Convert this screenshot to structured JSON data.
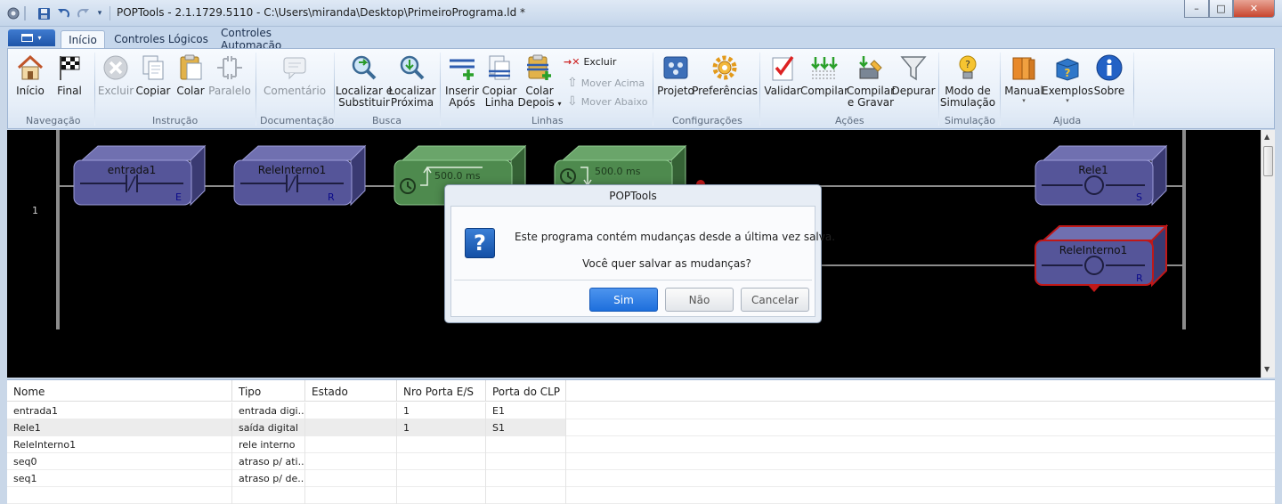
{
  "window": {
    "title": "POPTools - 2.1.1729.5110 - C:\\Users\\miranda\\Desktop\\PrimeiroPrograma.ld *",
    "minimize": "–",
    "maximize": "□",
    "close": "✕"
  },
  "tabs": [
    {
      "label": "Início",
      "active": true
    },
    {
      "label": "Controles Lógicos",
      "active": false
    },
    {
      "label": "Controles Automação",
      "active": false
    }
  ],
  "ribbon": {
    "groups": {
      "navegacao": "Navegação",
      "instrucao": "Instrução",
      "documentacao": "Documentação",
      "busca": "Busca",
      "linhas": "Linhas",
      "configuracoes": "Configurações",
      "acoes": "Ações",
      "simulacao": "Simulação",
      "ajuda": "Ajuda"
    },
    "buttons": {
      "inicio": "Início",
      "final": "Final",
      "excluir": "Excluir",
      "copiar": "Copiar",
      "colar": "Colar",
      "paralelo": "Paralelo",
      "comentario": "Comentário",
      "localizar_substituir_1": "Localizar e",
      "localizar_substituir_2": "Substituir",
      "localizar_proxima_1": "Localizar",
      "localizar_proxima_2": "Próxima",
      "inserir_apos_1": "Inserir",
      "inserir_apos_2": "Após",
      "copiar_linha_1": "Copiar",
      "copiar_linha_2": "Linha",
      "colar_depois_1": "Colar",
      "colar_depois_2": "Depois",
      "linha_excluir": "Excluir",
      "mover_acima": "Mover Acima",
      "mover_abaixo": "Mover Abaixo",
      "projeto": "Projeto",
      "preferencias": "Preferências",
      "validar": "Validar",
      "compilar": "Compilar",
      "compilar_gravar_1": "Compilar",
      "compilar_gravar_2": "e Gravar",
      "depurar": "Depurar",
      "modo_simulacao_1": "Modo de",
      "modo_simulacao_2": "Simulação",
      "manual": "Manual",
      "exemplos": "Exemplos",
      "sobre": "Sobre"
    }
  },
  "ladder": {
    "rung_number": "1",
    "elements": {
      "entrada1": {
        "name": "entrada1",
        "tag": "E"
      },
      "releinterno1_contact": {
        "name": "ReleInterno1",
        "tag": "R"
      },
      "timer1": {
        "value": "500.0 ms"
      },
      "timer2": {
        "value": "500.0 ms"
      },
      "rele1": {
        "name": "Rele1",
        "tag": "S"
      },
      "releinterno1_coil": {
        "name": "ReleInterno1",
        "tag": "R"
      }
    }
  },
  "table": {
    "columns": [
      "Nome",
      "Tipo",
      "Estado",
      "Nro Porta E/S",
      "Porta do CLP"
    ],
    "rows": [
      [
        "entrada1",
        "entrada digi...",
        "",
        "1",
        "E1"
      ],
      [
        "Rele1",
        "saída digital",
        "",
        "1",
        "S1"
      ],
      [
        "ReleInterno1",
        "rele interno",
        "",
        "",
        ""
      ],
      [
        "seq0",
        "atraso p/ ati...",
        "",
        "",
        ""
      ],
      [
        "seq1",
        "atraso p/ de...",
        "",
        "",
        ""
      ]
    ]
  },
  "dialog": {
    "title": "POPTools",
    "message1": "Este programa contém mudanças desde a última vez salva.",
    "message2": "Você quer salvar as mudanças?",
    "buttons": {
      "yes": "Sim",
      "no": "Não",
      "cancel": "Cancelar"
    }
  },
  "colors": {
    "accent": "#1d6fdc",
    "ladder_bg": "#000000",
    "element_blue": "#4a4a88",
    "element_green": "#4e8a4e",
    "element_red_border": "#c01818"
  }
}
